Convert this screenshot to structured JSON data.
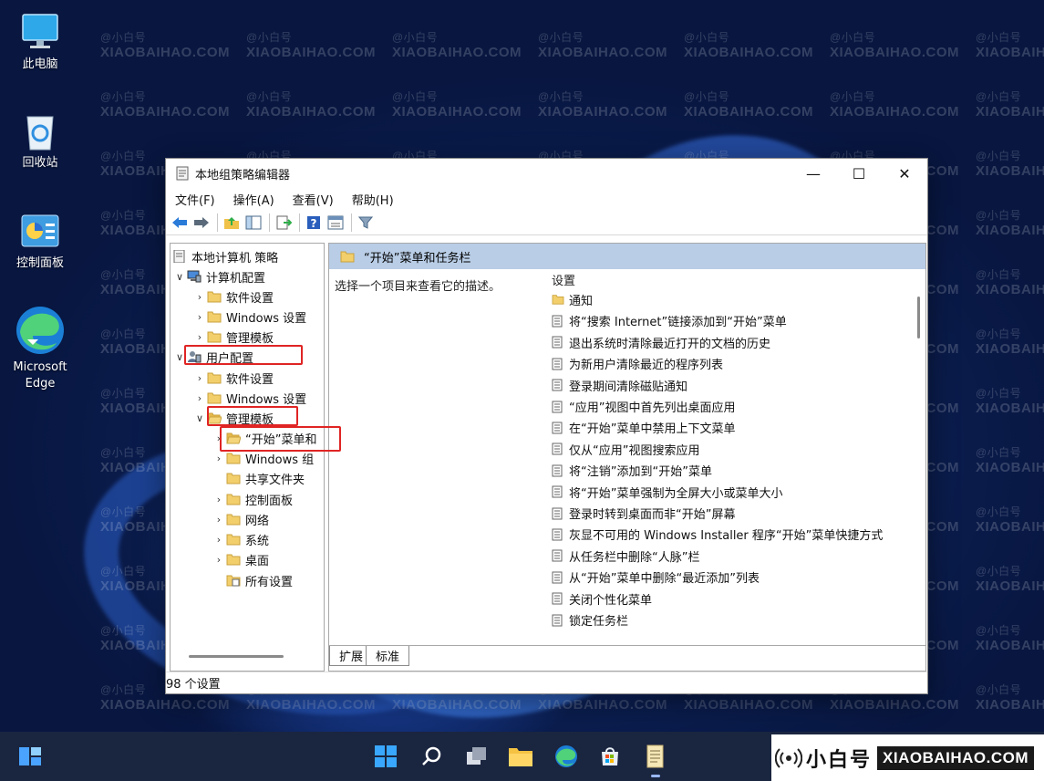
{
  "desktop": {
    "icons": [
      {
        "label": "此电脑"
      },
      {
        "label": "回收站"
      },
      {
        "label": "控制面板"
      },
      {
        "label": "Microsoft",
        "label2": "Edge"
      }
    ],
    "watermark": {
      "name": "@小白号",
      "domain": "XIAOBAIHAO.COM"
    }
  },
  "window": {
    "title": "本地组策略编辑器",
    "controls": {
      "minimize": "—",
      "maximize": "☐",
      "close": "✕"
    },
    "menu": [
      "文件(F)",
      "操作(A)",
      "查看(V)",
      "帮助(H)"
    ],
    "tree": [
      {
        "label": "本地计算机 策略"
      },
      {
        "label": "计算机配置"
      },
      {
        "label": "软件设置"
      },
      {
        "label": "Windows 设置"
      },
      {
        "label": "管理模板"
      },
      {
        "label": "用户配置"
      },
      {
        "label": "软件设置"
      },
      {
        "label": "Windows 设置"
      },
      {
        "label": "管理模板"
      },
      {
        "label": "“开始”菜单和"
      },
      {
        "label": "Windows 组"
      },
      {
        "label": "共享文件夹"
      },
      {
        "label": "控制面板"
      },
      {
        "label": "网络"
      },
      {
        "label": "系统"
      },
      {
        "label": "桌面"
      },
      {
        "label": "所有设置"
      }
    ],
    "detail": {
      "header": "“开始”菜单和任务栏",
      "description": "选择一个项目来查看它的描述。",
      "column_header": "设置",
      "items": [
        "通知",
        "将“搜索 Internet”链接添加到“开始”菜单",
        "退出系统时清除最近打开的文档的历史",
        "为新用户清除最近的程序列表",
        "登录期间清除磁贴通知",
        "“应用”视图中首先列出桌面应用",
        "在“开始”菜单中禁用上下文菜单",
        "仅从“应用”视图搜索应用",
        "将“注销”添加到“开始”菜单",
        "将“开始”菜单强制为全屏大小或菜单大小",
        "登录时转到桌面而非“开始”屏幕",
        "灰显不可用的 Windows Installer 程序“开始”菜单快捷方式",
        "从任务栏中删除“人脉”栏",
        "从“开始”菜单中删除“最近添加”列表",
        "关闭个性化菜单",
        "锁定任务栏"
      ],
      "tabs": [
        "扩展",
        "标准"
      ]
    },
    "status": "98 个设置"
  },
  "brand": {
    "name": "小白号",
    "domain": "XIAOBAIHAO.COM"
  },
  "colors": {
    "highlight_box": "#e02424",
    "detail_header": "#b9cde6",
    "taskbar": "#1a2540"
  }
}
